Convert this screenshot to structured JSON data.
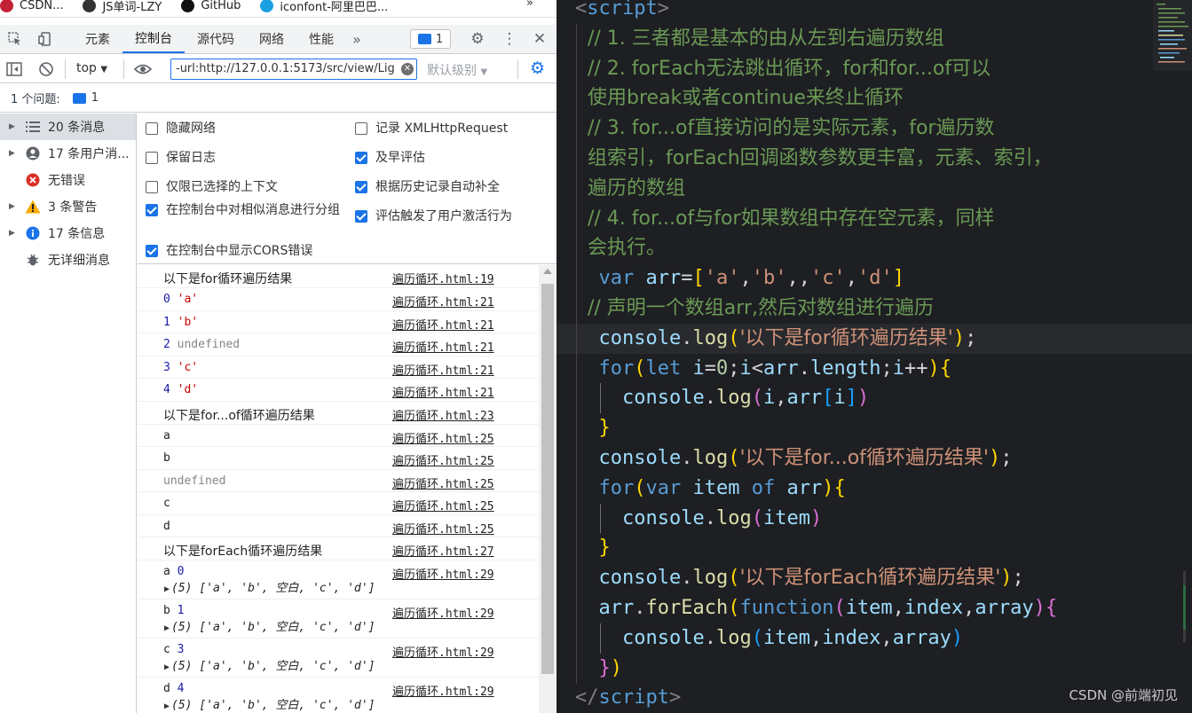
{
  "bookmarks": [
    {
      "label": "CSDN...",
      "color": "#c32136"
    },
    {
      "label": "JS单词-LZY",
      "color": "#333333"
    },
    {
      "label": "GitHub",
      "color": "#111111"
    },
    {
      "label": "iconfont-阿里巴巴...",
      "color": "#1ba0e1"
    }
  ],
  "bookmarks_more": "»",
  "devtools": {
    "tabs": [
      "元素",
      "控制台",
      "源代码",
      "网络",
      "性能"
    ],
    "active_tab": "控制台",
    "tabs_overflow": "»",
    "issue_count": "1",
    "context": "top",
    "filter_value": "-url:http://127.0.0.1:5173/src/view/Lig",
    "levels": "默认级别",
    "issue_bar": {
      "label": "1 个问题:",
      "count": "1"
    },
    "sidebar": [
      {
        "label": "20 条消息",
        "icon": "list-icon",
        "arrow": true,
        "selected": true
      },
      {
        "label": "17 条用户消...",
        "icon": "user-icon",
        "arrow": true
      },
      {
        "label": "无错误",
        "icon": "error-icon",
        "arrow": false
      },
      {
        "label": "3 条警告",
        "icon": "warning-icon",
        "arrow": true
      },
      {
        "label": "17 条信息",
        "icon": "info-icon",
        "arrow": true
      },
      {
        "label": "无详细消息",
        "icon": "bug-icon",
        "arrow": false
      }
    ],
    "settings": [
      {
        "label": "隐藏网络",
        "checked": false
      },
      {
        "label": "记录 XMLHttpRequest",
        "checked": false
      },
      {
        "label": "保留日志",
        "checked": false
      },
      {
        "label": "及早评估",
        "checked": true
      },
      {
        "label": "仅限已选择的上下文",
        "checked": false
      },
      {
        "label": "根据历史记录自动补全",
        "checked": true
      },
      {
        "label": "在控制台中对相似消息进行分组",
        "checked": true
      },
      {
        "label": "评估触发了用户激活行为",
        "checked": true
      },
      {
        "label": "在控制台中显示CORS错误",
        "checked": true
      }
    ],
    "console_rows": [
      {
        "parts": [
          [
            "以下是for循环遍历结果",
            "plain"
          ]
        ],
        "src": "遍历循环.html:19",
        "cjk": true
      },
      {
        "parts": [
          [
            "0 ",
            "num"
          ],
          [
            "'a'",
            "str"
          ]
        ],
        "src": "遍历循环.html:21"
      },
      {
        "parts": [
          [
            "1 ",
            "num"
          ],
          [
            "'b'",
            "str"
          ]
        ],
        "src": "遍历循环.html:21"
      },
      {
        "parts": [
          [
            "2 ",
            "num"
          ],
          [
            "undefined",
            "undef"
          ]
        ],
        "src": "遍历循环.html:21"
      },
      {
        "parts": [
          [
            "3 ",
            "num"
          ],
          [
            "'c'",
            "str"
          ]
        ],
        "src": "遍历循环.html:21"
      },
      {
        "parts": [
          [
            "4 ",
            "num"
          ],
          [
            "'d'",
            "str"
          ]
        ],
        "src": "遍历循环.html:21"
      },
      {
        "parts": [
          [
            "以下是for...of循环遍历结果",
            "plain"
          ]
        ],
        "src": "遍历循环.html:23",
        "cjk": true
      },
      {
        "parts": [
          [
            "a",
            "plain"
          ]
        ],
        "src": "遍历循环.html:25"
      },
      {
        "parts": [
          [
            "b",
            "plain"
          ]
        ],
        "src": "遍历循环.html:25"
      },
      {
        "parts": [
          [
            "undefined",
            "undef"
          ]
        ],
        "src": "遍历循环.html:25"
      },
      {
        "parts": [
          [
            "c",
            "plain"
          ]
        ],
        "src": "遍历循环.html:25"
      },
      {
        "parts": [
          [
            "d",
            "plain"
          ]
        ],
        "src": "遍历循环.html:25"
      },
      {
        "parts": [
          [
            "以下是forEach循环遍历结果",
            "plain"
          ]
        ],
        "src": "遍历循环.html:27",
        "cjk": true
      },
      {
        "parts": [
          [
            "a ",
            "plain"
          ],
          [
            "0",
            "num"
          ]
        ],
        "src": "遍历循环.html:29",
        "array": "(5) ['a', 'b', 空白, 'c', 'd']"
      },
      {
        "parts": [
          [
            "b ",
            "plain"
          ],
          [
            "1",
            "num"
          ]
        ],
        "src": "遍历循环.html:29",
        "array": "(5) ['a', 'b', 空白, 'c', 'd']"
      },
      {
        "parts": [
          [
            "c ",
            "plain"
          ],
          [
            "3",
            "num"
          ]
        ],
        "src": "遍历循环.html:29",
        "array": "(5) ['a', 'b', 空白, 'c', 'd']"
      },
      {
        "parts": [
          [
            "d ",
            "plain"
          ],
          [
            "4",
            "num"
          ]
        ],
        "src": "遍历循环.html:29",
        "array": "(5) ['a', 'b', 空白, 'c', 'd']"
      }
    ]
  },
  "editor": {
    "lines": [
      [
        [
          "<",
          "tag"
        ],
        [
          "script",
          "tagn"
        ],
        [
          ">",
          "tag"
        ]
      ],
      [
        [
          "  // 1. 三者都是基本的由从左到右遍历数组",
          "cmt"
        ]
      ],
      [
        [
          "  // 2. forEach无法跳出循环，for和for...of可以",
          "cmt"
        ]
      ],
      [
        [
          "  使用break或者continue来终止循环",
          "cmt"
        ]
      ],
      [
        [
          "  // 3. for...of直接访问的是实际元素，for遍历数",
          "cmt"
        ]
      ],
      [
        [
          "  组索引，forEach回调函数参数更丰富，元素、索引，",
          "cmt"
        ]
      ],
      [
        [
          "  遍历的数组",
          "cmt"
        ]
      ],
      [
        [
          "  // 4. for...of与for如果数组中存在空元素，同样",
          "cmt"
        ]
      ],
      [
        [
          "  会执行。",
          "cmt"
        ]
      ],
      [
        [
          "  ",
          "punc"
        ],
        [
          "var",
          "kw"
        ],
        [
          " ",
          "punc"
        ],
        [
          "arr",
          "var"
        ],
        [
          "=",
          "punc"
        ],
        [
          "[",
          "b1"
        ],
        [
          "'a'",
          "strq"
        ],
        [
          ",",
          "punc"
        ],
        [
          "'b'",
          "strq"
        ],
        [
          ",,",
          "punc"
        ],
        [
          "'c'",
          "strq"
        ],
        [
          ",",
          "punc"
        ],
        [
          "'d'",
          "strq"
        ],
        [
          "]",
          "b1"
        ]
      ],
      [
        [
          "  // 声明一个数组arr,然后对数组进行遍历",
          "cmt"
        ]
      ],
      [
        [
          "  ",
          "punc"
        ],
        [
          "console",
          "var"
        ],
        [
          ".",
          "punc"
        ],
        [
          "log",
          "fn"
        ],
        [
          "(",
          "b1"
        ],
        [
          "'以下是for循环遍历结果'",
          "strq"
        ],
        [
          ")",
          "b1"
        ],
        [
          ";",
          "punc"
        ]
      ],
      [
        [
          "  ",
          "punc"
        ],
        [
          "for",
          "kw"
        ],
        [
          "(",
          "b1"
        ],
        [
          "let",
          "kw"
        ],
        [
          " ",
          "punc"
        ],
        [
          "i",
          "var"
        ],
        [
          "=",
          "punc"
        ],
        [
          "0",
          "numl"
        ],
        [
          ";",
          "punc"
        ],
        [
          "i",
          "var"
        ],
        [
          "<",
          "punc"
        ],
        [
          "arr",
          "var"
        ],
        [
          ".",
          "punc"
        ],
        [
          "length",
          "var"
        ],
        [
          ";",
          "punc"
        ],
        [
          "i",
          "var"
        ],
        [
          "++",
          "punc"
        ],
        [
          ")",
          "b1"
        ],
        [
          "{",
          "b1"
        ]
      ],
      [
        [
          "    ",
          "punc"
        ],
        [
          "console",
          "var"
        ],
        [
          ".",
          "punc"
        ],
        [
          "log",
          "fn"
        ],
        [
          "(",
          "b2"
        ],
        [
          "i",
          "var"
        ],
        [
          ",",
          "punc"
        ],
        [
          "arr",
          "var"
        ],
        [
          "[",
          "b3"
        ],
        [
          "i",
          "var"
        ],
        [
          "]",
          "b3"
        ],
        [
          ")",
          "b2"
        ]
      ],
      [
        [
          "  ",
          "punc"
        ],
        [
          "}",
          "b1"
        ]
      ],
      [
        [
          "  ",
          "punc"
        ],
        [
          "console",
          "var"
        ],
        [
          ".",
          "punc"
        ],
        [
          "log",
          "fn"
        ],
        [
          "(",
          "b1"
        ],
        [
          "'以下是for...of循环遍历结果'",
          "strq"
        ],
        [
          ")",
          "b1"
        ],
        [
          ";",
          "punc"
        ]
      ],
      [
        [
          "  ",
          "punc"
        ],
        [
          "for",
          "kw"
        ],
        [
          "(",
          "b1"
        ],
        [
          "var",
          "kw"
        ],
        [
          " ",
          "punc"
        ],
        [
          "item",
          "var"
        ],
        [
          " ",
          "punc"
        ],
        [
          "of",
          "kw"
        ],
        [
          " ",
          "punc"
        ],
        [
          "arr",
          "var"
        ],
        [
          ")",
          "b1"
        ],
        [
          "{",
          "b1"
        ]
      ],
      [
        [
          "    ",
          "punc"
        ],
        [
          "console",
          "var"
        ],
        [
          ".",
          "punc"
        ],
        [
          "log",
          "fn"
        ],
        [
          "(",
          "b2"
        ],
        [
          "item",
          "var"
        ],
        [
          ")",
          "b2"
        ]
      ],
      [
        [
          "  ",
          "punc"
        ],
        [
          "}",
          "b1"
        ]
      ],
      [
        [
          "  ",
          "punc"
        ],
        [
          "console",
          "var"
        ],
        [
          ".",
          "punc"
        ],
        [
          "log",
          "fn"
        ],
        [
          "(",
          "b1"
        ],
        [
          "'以下是forEach循环遍历结果'",
          "strq"
        ],
        [
          ")",
          "b1"
        ],
        [
          ";",
          "punc"
        ]
      ],
      [
        [
          "  ",
          "punc"
        ],
        [
          "arr",
          "var"
        ],
        [
          ".",
          "punc"
        ],
        [
          "forEach",
          "fn"
        ],
        [
          "(",
          "b1"
        ],
        [
          "function",
          "kw"
        ],
        [
          "(",
          "b2"
        ],
        [
          "item",
          "var"
        ],
        [
          ",",
          "punc"
        ],
        [
          "index",
          "var"
        ],
        [
          ",",
          "punc"
        ],
        [
          "array",
          "var"
        ],
        [
          ")",
          "b2"
        ],
        [
          "{",
          "b2"
        ]
      ],
      [
        [
          "    ",
          "punc"
        ],
        [
          "console",
          "var"
        ],
        [
          ".",
          "punc"
        ],
        [
          "log",
          "fn"
        ],
        [
          "(",
          "b3"
        ],
        [
          "item",
          "var"
        ],
        [
          ",",
          "punc"
        ],
        [
          "index",
          "var"
        ],
        [
          ",",
          "punc"
        ],
        [
          "array",
          "var"
        ],
        [
          ")",
          "b3"
        ]
      ],
      [
        [
          "  ",
          "punc"
        ],
        [
          "}",
          "b2"
        ],
        [
          ")",
          "b1"
        ]
      ],
      [
        [
          "</",
          "tag"
        ],
        [
          "script",
          "tagn"
        ],
        [
          ">",
          "tag"
        ]
      ]
    ],
    "current_line": 11,
    "watermark": "CSDN @前端初见"
  }
}
